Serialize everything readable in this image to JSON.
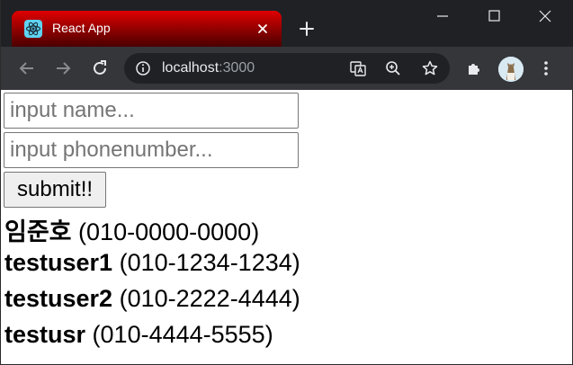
{
  "browser": {
    "tab": {
      "title": "React App",
      "favicon": "react-logo-icon"
    },
    "address": {
      "host": "localhost",
      "port": ":3000"
    },
    "icons": [
      "back-icon",
      "forward-icon",
      "reload-icon",
      "info-icon",
      "translate-icon",
      "zoom-icon",
      "star-icon",
      "extensions-icon",
      "menu-icon"
    ],
    "accent_colors": {
      "tab": "#b40000",
      "frame": "#202124",
      "toolbar": "#35363a"
    }
  },
  "form": {
    "name_placeholder": "input name...",
    "phone_placeholder": "input phonenumber...",
    "name_value": "",
    "phone_value": "",
    "submit_label": "submit!!"
  },
  "contacts": [
    {
      "name": "임준호",
      "phone": "(010-0000-0000)"
    },
    {
      "name": "testuser1",
      "phone": "(010-1234-1234)"
    },
    {
      "name": "testuser2",
      "phone": "(010-2222-4444)"
    },
    {
      "name": "testusr",
      "phone": "(010-4444-5555)"
    }
  ]
}
